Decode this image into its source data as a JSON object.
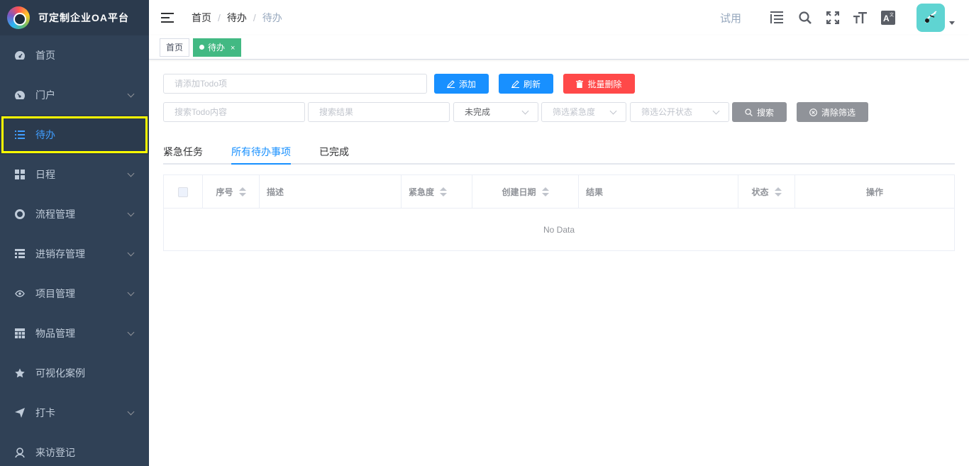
{
  "app": {
    "title": "可定制企业OA平台"
  },
  "sidebar": {
    "items": [
      {
        "label": "首页",
        "icon": "dashboard-icon",
        "has_children": false,
        "active": false
      },
      {
        "label": "门户",
        "icon": "portal-icon",
        "has_children": true,
        "active": false
      },
      {
        "label": "待办",
        "icon": "list-icon",
        "has_children": false,
        "active": true
      },
      {
        "label": "日程",
        "icon": "grid-icon",
        "has_children": true,
        "active": false
      },
      {
        "label": "流程管理",
        "icon": "lifebuoy-icon",
        "has_children": true,
        "active": false
      },
      {
        "label": "进销存管理",
        "icon": "tree-table-icon",
        "has_children": true,
        "active": false
      },
      {
        "label": "项目管理",
        "icon": "eye-icon",
        "has_children": true,
        "active": false
      },
      {
        "label": "物品管理",
        "icon": "table-icon",
        "has_children": true,
        "active": false
      },
      {
        "label": "可视化案例",
        "icon": "star-icon",
        "has_children": false,
        "active": false
      },
      {
        "label": "打卡",
        "icon": "send-icon",
        "has_children": true,
        "active": false
      },
      {
        "label": "来访登记",
        "icon": "visitor-icon",
        "has_children": false,
        "active": false
      }
    ]
  },
  "navbar": {
    "breadcrumb": [
      "首页",
      "待办",
      "待办"
    ],
    "trial_label": "试用",
    "icons": [
      "menu-search-icon",
      "search-icon",
      "fullscreen-icon",
      "font-size-icon",
      "translate-icon"
    ]
  },
  "tags": [
    {
      "label": "首页",
      "active": false
    },
    {
      "label": "待办",
      "active": true,
      "close": "×"
    }
  ],
  "toolbar": {
    "add_placeholder": "请添加Todo项",
    "add_label": "添加",
    "refresh_label": "刷新",
    "batch_delete_label": "批量删除"
  },
  "filters": {
    "content_placeholder": "搜索Todo内容",
    "result_placeholder": "搜索结果",
    "status_value": "未完成",
    "urgency_placeholder": "筛选紧急度",
    "public_placeholder": "筛选公开状态",
    "search_label": "搜索",
    "clear_label": "清除筛选"
  },
  "tabs": [
    {
      "label": "紧急任务",
      "active": false
    },
    {
      "label": "所有待办事项",
      "active": true
    },
    {
      "label": "已完成",
      "active": false
    }
  ],
  "table": {
    "columns": [
      "序号",
      "描述",
      "紧急度",
      "创建日期",
      "结果",
      "状态",
      "操作"
    ],
    "empty_text": "No Data"
  },
  "colors": {
    "sidebar_bg": "#304156",
    "primary": "#1890ff",
    "danger": "#ff4949",
    "tag_active": "#42b983",
    "highlight": "#ffff00"
  }
}
